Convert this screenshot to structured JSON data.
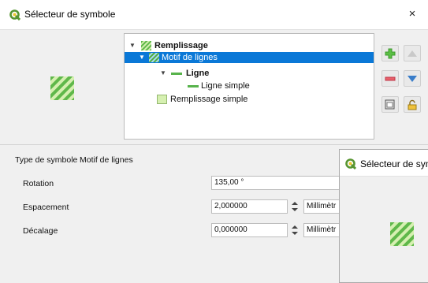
{
  "window": {
    "title": "Sélecteur de symbole",
    "close_glyph": "×"
  },
  "tree": {
    "items": [
      {
        "label": "Remplissage",
        "icon": "hatch-fill-icon",
        "bold": true,
        "expanded": true
      },
      {
        "label": "Motif de lignes",
        "icon": "hatch-fill-icon",
        "selected": true,
        "expanded": true
      },
      {
        "label": "Ligne",
        "icon": "line-icon",
        "bold": true,
        "expanded": true
      },
      {
        "label": "Ligne simple",
        "icon": "line-icon"
      },
      {
        "label": "Remplissage simple",
        "icon": "simple-fill-icon"
      }
    ]
  },
  "tools": [
    "add-layer-icon",
    "move-up-icon",
    "remove-layer-icon",
    "move-down-icon",
    "duplicate-layer-icon",
    "lock-icon"
  ],
  "form": {
    "symbol_type_label": "Type de symbole",
    "symbol_type_value": "Motif de lignes",
    "rotation_label": "Rotation",
    "rotation_value": "135,00 °",
    "spacing_label": "Espacement",
    "spacing_value": "2,000000",
    "spacing_unit": "Millimètr",
    "offset_label": "Décalage",
    "offset_value": "0,000000",
    "offset_unit": "Millimètr"
  },
  "second_window": {
    "title": "Sélecteur de sym"
  },
  "colors": {
    "accent": "#0a78d7",
    "hatch_green": "#5fb84a",
    "fill_light_green": "#d6f0b1",
    "qgis_green": "#589632"
  }
}
